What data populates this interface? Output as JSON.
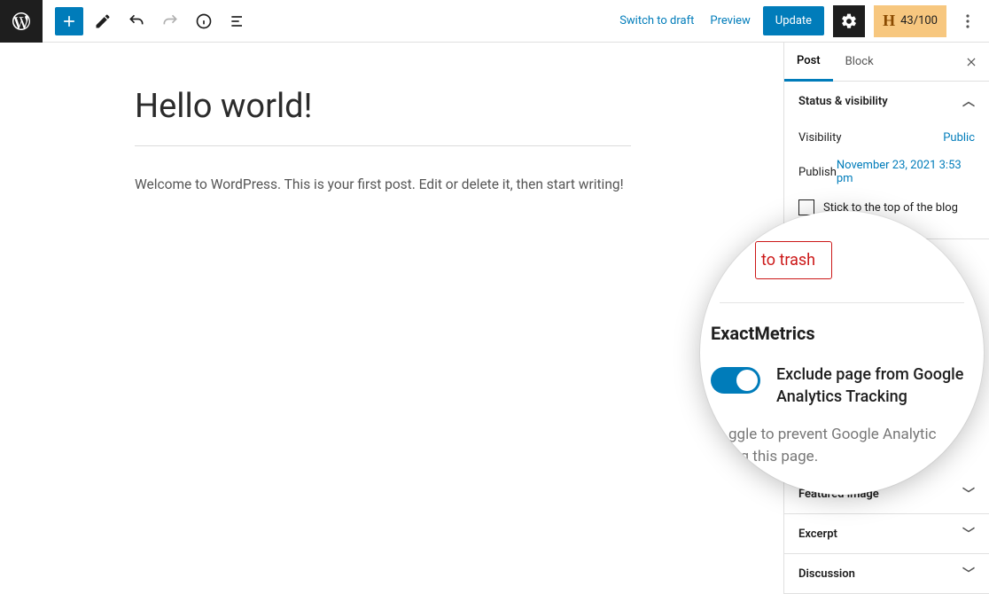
{
  "toolbar": {
    "switch_draft": "Switch to draft",
    "preview": "Preview",
    "update": "Update",
    "score": "43/100"
  },
  "editor": {
    "title": "Hello world!",
    "body": "Welcome to WordPress. This is your first post. Edit or delete it, then start writing!"
  },
  "sidebar": {
    "tabs": {
      "post": "Post",
      "block": "Block"
    },
    "status": {
      "heading": "Status & visibility",
      "visibility_k": "Visibility",
      "visibility_v": "Public",
      "publish_k": "Publish",
      "publish_v": "November 23, 2021 3:53 pm",
      "stick": "Stick to the top of the blog"
    },
    "panels": {
      "featured": "Featured image",
      "excerpt": "Excerpt",
      "discussion": "Discussion"
    }
  },
  "magnifier": {
    "trash": " to trash",
    "title": "ExactMetrics",
    "toggle_label": "Exclude page from Google Analytics Tracking",
    "desc_a": "ggle to prevent Google Analytic",
    "desc_b": "ing this page."
  }
}
